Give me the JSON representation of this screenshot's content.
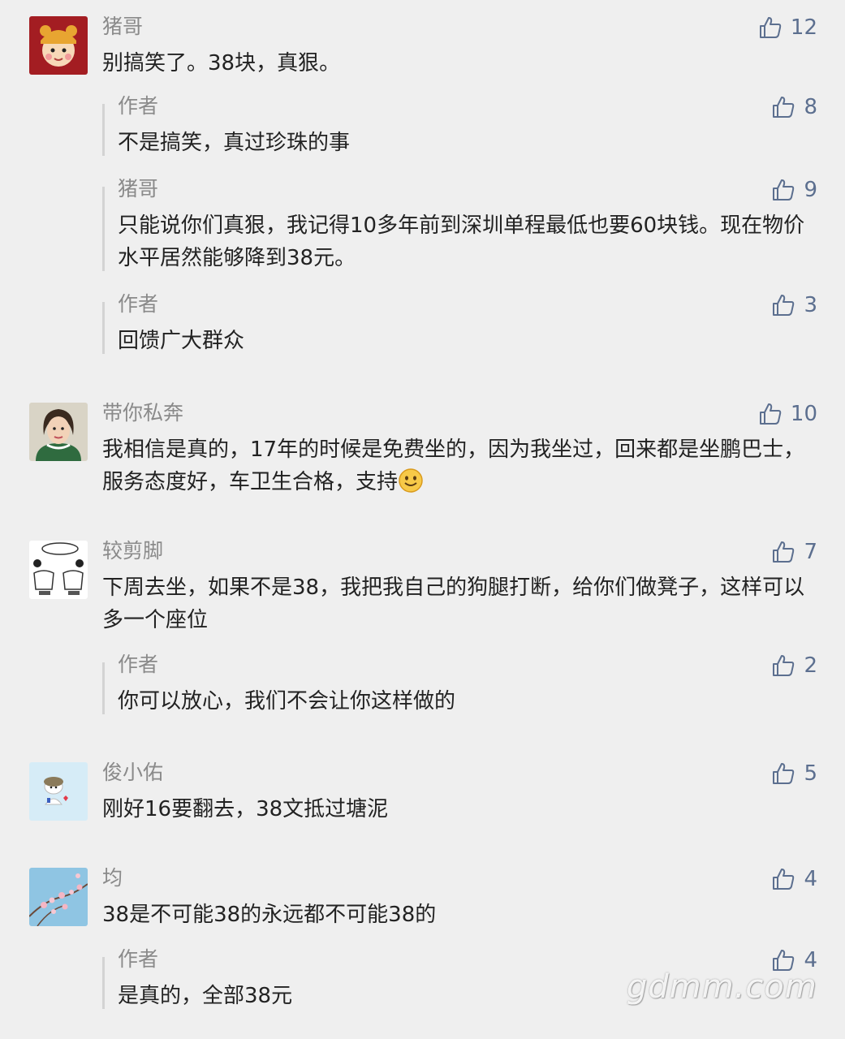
{
  "comments": [
    {
      "user": "猪哥",
      "text": "别搞笑了。38块，真狠。",
      "likes": "12",
      "replies": [
        {
          "user": "作者",
          "text": "不是搞笑，真过珍珠的事",
          "likes": "8"
        },
        {
          "user": "猪哥",
          "text": "只能说你们真狠，我记得10多年前到深圳单程最低也要60块钱。现在物价水平居然能够降到38元。",
          "likes": "9"
        },
        {
          "user": "作者",
          "text": "回馈广大群众",
          "likes": "3"
        }
      ]
    },
    {
      "user": "带你私奔",
      "text": "我相信是真的，17年的时候是免费坐的，因为我坐过，回来都是坐鹏巴士，服务态度好，车卫生合格，支持",
      "likes": "10",
      "replies": []
    },
    {
      "user": "较剪脚",
      "text": "下周去坐，如果不是38，我把我自己的狗腿打断，给你们做凳子，这样可以多一个座位",
      "likes": "7",
      "replies": [
        {
          "user": "作者",
          "text": "你可以放心，我们不会让你这样做的",
          "likes": "2"
        }
      ]
    },
    {
      "user": "俊小佑",
      "text": "刚好16要翻去，38文抵过塘泥",
      "likes": "5",
      "replies": []
    },
    {
      "user": "均",
      "text": "38是不可能38的永远都不可能38的",
      "likes": "4",
      "replies": [
        {
          "user": "作者",
          "text": "是真的，全部38元",
          "likes": "4"
        }
      ]
    }
  ],
  "watermark": "gdmm.com",
  "icons": {
    "like": "thumbs-up-icon",
    "emoji": "smiley-emoji-icon"
  },
  "colors": {
    "background": "#efefef",
    "name": "#8a8a8a",
    "like": "#5c6f8f",
    "text": "#222222"
  }
}
